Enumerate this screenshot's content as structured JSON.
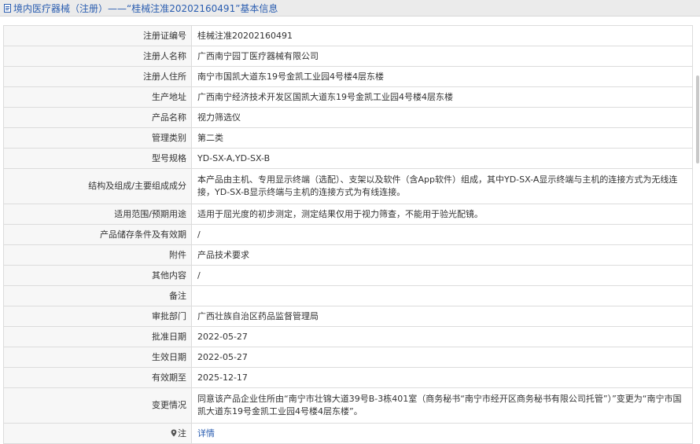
{
  "header": {
    "title": "境内医疗器械（注册）——“桂械注准20202160491”基本信息"
  },
  "fields": [
    {
      "label": "注册证编号",
      "value": "桂械注准20202160491"
    },
    {
      "label": "注册人名称",
      "value": "广西南宁园丁医疗器械有限公司"
    },
    {
      "label": "注册人住所",
      "value": "南宁市国凯大道东19号金凯工业园4号楼4层东楼"
    },
    {
      "label": "生产地址",
      "value": "广西南宁经济技术开发区国凯大道东19号金凯工业园4号楼4层东楼"
    },
    {
      "label": "产品名称",
      "value": "视力筛选仪"
    },
    {
      "label": "管理类别",
      "value": "第二类"
    },
    {
      "label": "型号规格",
      "value": "YD-SX-A,YD-SX-B"
    },
    {
      "label": "结构及组成/主要组成成分",
      "value": "本产品由主机、专用显示终端（选配）、支架以及软件（含App软件）组成，其中YD-SX-A显示终端与主机的连接方式为无线连接，YD-SX-B显示终端与主机的连接方式为有线连接。"
    },
    {
      "label": "适用范围/预期用途",
      "value": "适用于屈光度的初步测定，测定结果仅用于视力筛查，不能用于验光配镜。"
    },
    {
      "label": "产品储存条件及有效期",
      "value": "/"
    },
    {
      "label": "附件",
      "value": "产品技术要求"
    },
    {
      "label": "其他内容",
      "value": "/"
    },
    {
      "label": "备注",
      "value": ""
    },
    {
      "label": "审批部门",
      "value": "广西壮族自治区药品监督管理局"
    },
    {
      "label": "批准日期",
      "value": "2022-05-27"
    },
    {
      "label": "生效日期",
      "value": "2022-05-27"
    },
    {
      "label": "有效期至",
      "value": "2025-12-17"
    },
    {
      "label": "变更情况",
      "value": "同意该产品企业住所由“南宁市壮锦大道39号B-3栋401室（商务秘书“南宁市经开区商务秘书有限公司托管”）”变更为“南宁市国凯大道东19号金凯工业园4号楼4层东楼”。"
    }
  ],
  "note": {
    "label": "注",
    "link": "详情",
    "icon": "location-pin-icon"
  },
  "colors": {
    "title": "#2a5db0",
    "link": "#2a5db0",
    "border": "#dcdcdc",
    "label_bg": "#f7f7f7",
    "header_bg": "#ebebeb"
  }
}
